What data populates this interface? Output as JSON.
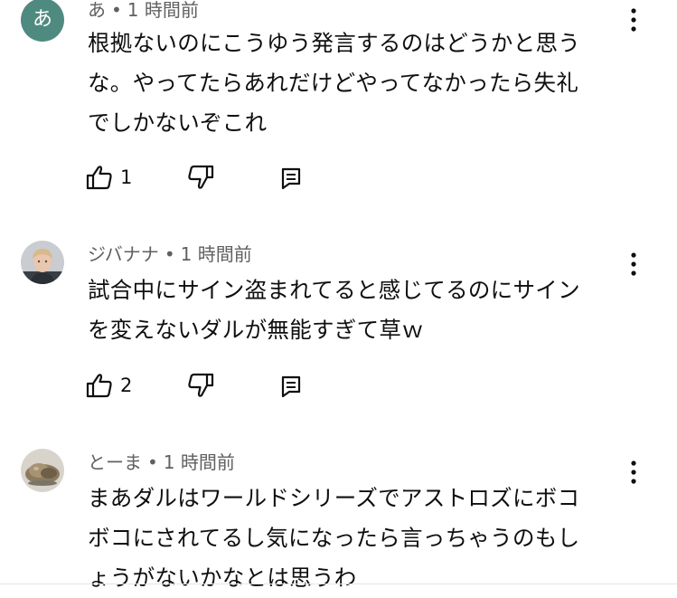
{
  "comments": [
    {
      "avatar_letter": "あ",
      "author": "あ",
      "separator": "•",
      "time": "1 時間前",
      "lines": [
        "根拠ないのにこうゆう発言するのはどうかと思う",
        "な。やってたらあれだけどやってなかったら失礼",
        "でしかないぞこれ"
      ],
      "likes": "1",
      "avatar_color": "#4f8a80"
    },
    {
      "author": "ジバナナ",
      "separator": "•",
      "time": "1 時間前",
      "lines": [
        "試合中にサイン盗まれてると感じてるのにサイン",
        "を変えないダルが無能すぎて草ｗ"
      ],
      "likes": "2"
    },
    {
      "author": "とーま",
      "separator": "•",
      "time": "1 時間前",
      "lines": [
        "まあダルはワールドシリーズでアストロズにボコ",
        "ボコにされてるし気になったら言っちゃうのもし",
        "ょうがないかなとは思うわ"
      ]
    }
  ],
  "icons": {
    "like": "thumb-up-icon",
    "dislike": "thumb-down-icon",
    "reply": "comment-reply-icon",
    "more": "more-vert-icon"
  }
}
